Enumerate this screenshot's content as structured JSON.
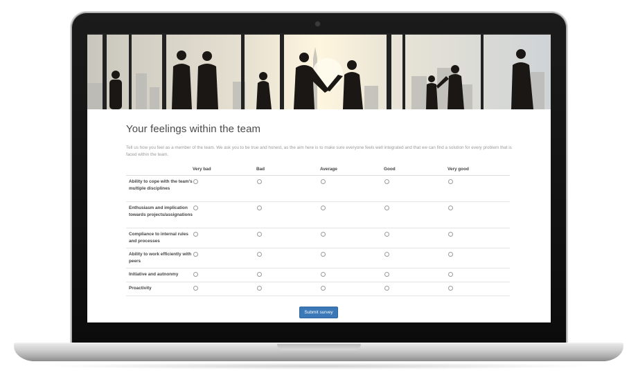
{
  "survey": {
    "title": "Your feelings within the team",
    "description": "Tell us how you feel as a member of the team. We ask you to be true and honest, as the aim here is to make sure everyone feels well integrated and that we can find a solution for every problem that is faced within the team.",
    "columns": [
      "Very bad",
      "Bad",
      "Average",
      "Good",
      "Very good"
    ],
    "rows": [
      "Ability to cope with the team's multiple disciplines",
      "Enthusiasm and implication towards projects/assignations",
      "Compliance to internal rules and processes",
      "Ability to work efficiently with peers",
      "Initiative and autnonmy",
      "Proactivity"
    ],
    "submit_label": "Submit survey"
  },
  "colors": {
    "accent": "#3a78b8",
    "bezel": "#111111",
    "title": "#4a4a4a"
  }
}
